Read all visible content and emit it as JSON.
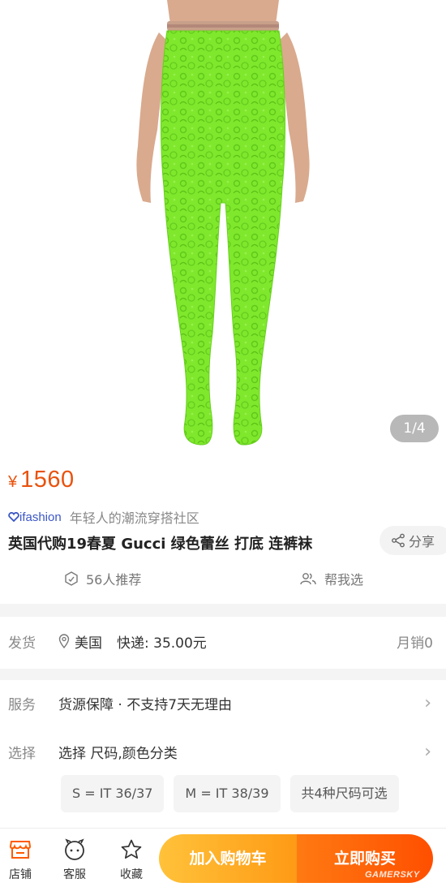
{
  "gallery": {
    "pager": "1/4",
    "watermark": "GAMERSKY"
  },
  "price": {
    "symbol": "¥",
    "value": "1560"
  },
  "brand": {
    "logo_text": "ifashion",
    "tagline": "年轻人的潮流穿搭社区"
  },
  "product": {
    "title": "英国代购19春夏 Gucci 绿色蕾丝 打底 连裤袜"
  },
  "share": {
    "label": "分享"
  },
  "meta": {
    "recommend": "56人推荐",
    "help_choose": "帮我选"
  },
  "shipping": {
    "label": "发货",
    "location": "美国",
    "fee": "快递: 35.00元",
    "sales": "月销0"
  },
  "service": {
    "label": "服务",
    "value": "货源保障 · 不支持7天无理由"
  },
  "select": {
    "label": "选择",
    "value": "选择 尺码,颜色分类",
    "options": [
      "S = IT 36/37",
      "M = IT 38/39",
      "共4种尺码可选"
    ]
  },
  "bottom_bar": {
    "store": "店铺",
    "service": "客服",
    "favorite": "收藏",
    "add_cart": "加入购物车",
    "buy_now": "立即购买"
  },
  "colors": {
    "accent": "#e8530e",
    "brand_blue": "#3a56c5",
    "tights_green": "#7fe82c"
  }
}
